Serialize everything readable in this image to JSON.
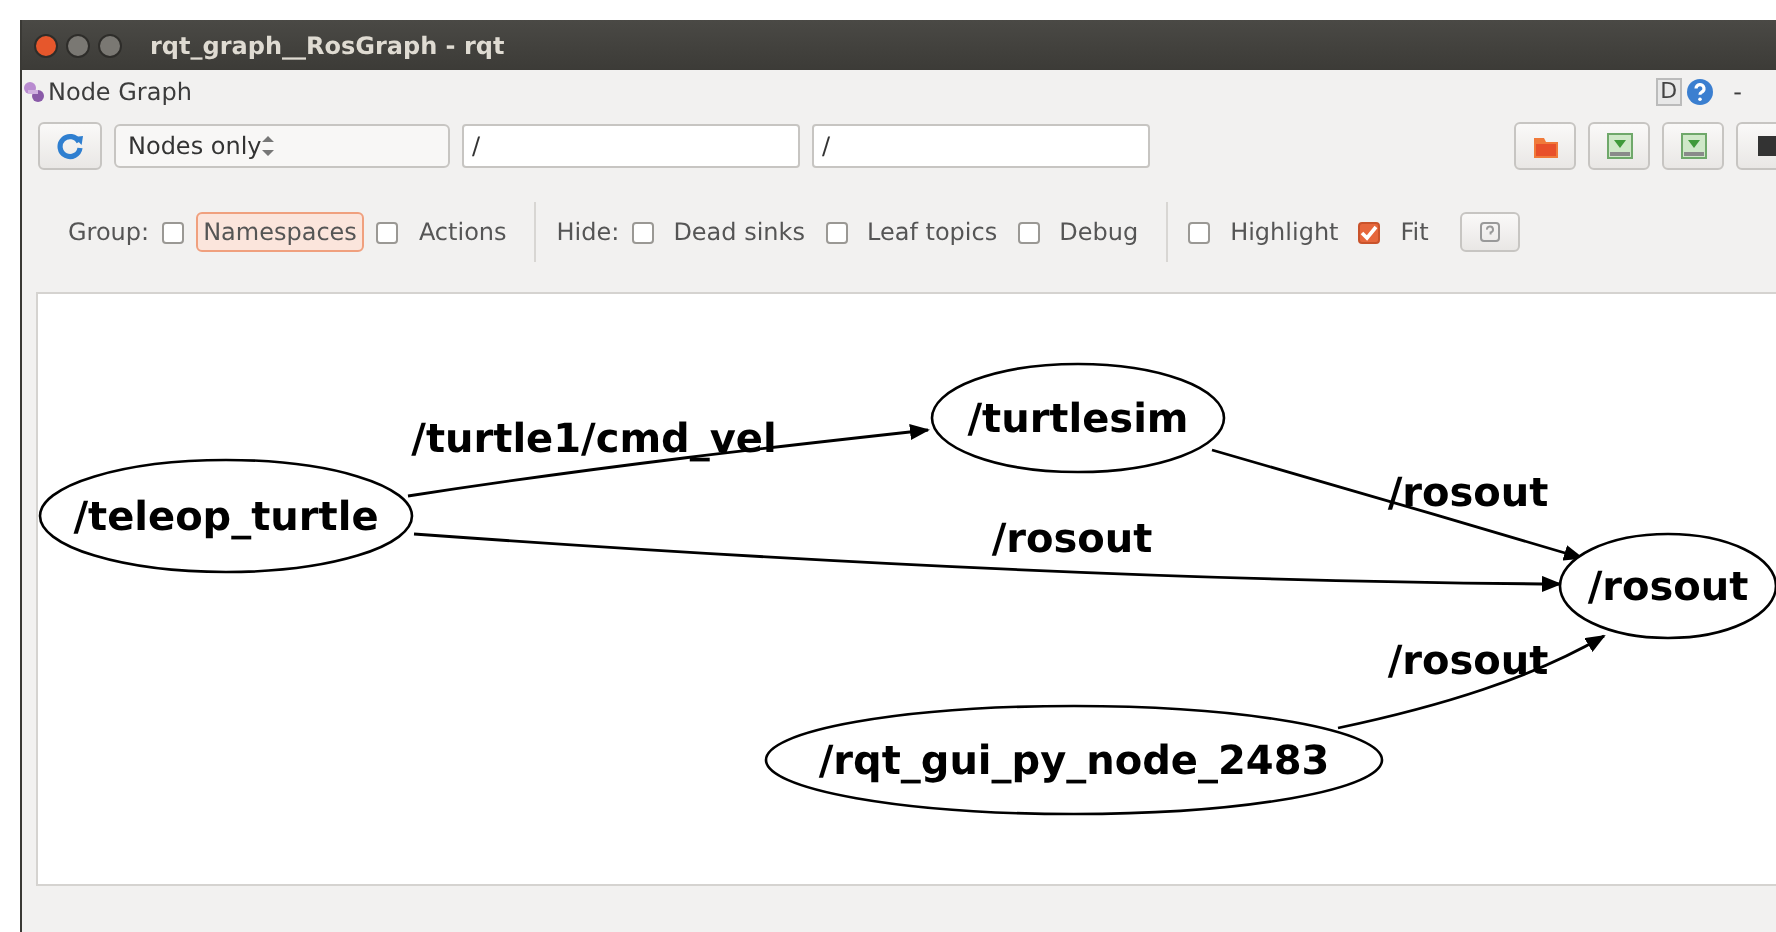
{
  "window": {
    "title": "rqt_graph__RosGraph - rqt"
  },
  "plugin": {
    "title": "Node Graph",
    "badge": "D",
    "menu": "-"
  },
  "toolbar": {
    "graph_type": "Nodes only",
    "filters": [
      {
        "value": "/"
      },
      {
        "value": "/"
      }
    ]
  },
  "options": [
    {
      "label": "Group:",
      "checkboxes": [
        {
          "label": "Namespaces",
          "checked": false,
          "focused": true
        },
        {
          "label": "Actions",
          "checked": false,
          "focused": false
        }
      ]
    },
    {
      "label": "Hide:",
      "checkboxes": [
        {
          "label": "Dead sinks",
          "checked": false,
          "focused": false
        },
        {
          "label": "Leaf topics",
          "checked": false,
          "focused": false
        },
        {
          "label": "Debug",
          "checked": false,
          "focused": false
        }
      ]
    },
    {
      "checkboxes": [
        {
          "label": "Highlight",
          "checked": false,
          "focused": false
        },
        {
          "label": "Fit",
          "checked": true,
          "focused": false
        }
      ]
    }
  ],
  "graph": {
    "nodes": [
      {
        "label": "/teleop_turtle"
      },
      {
        "label": "/turtlesim"
      },
      {
        "label": "/rosout"
      },
      {
        "label": "/rqt_gui_py_node_2483"
      }
    ],
    "edges": [
      {
        "label": "/turtle1/cmd_vel"
      },
      {
        "label": "/rosout"
      },
      {
        "label": "/rosout"
      },
      {
        "label": "/rosout"
      }
    ]
  }
}
